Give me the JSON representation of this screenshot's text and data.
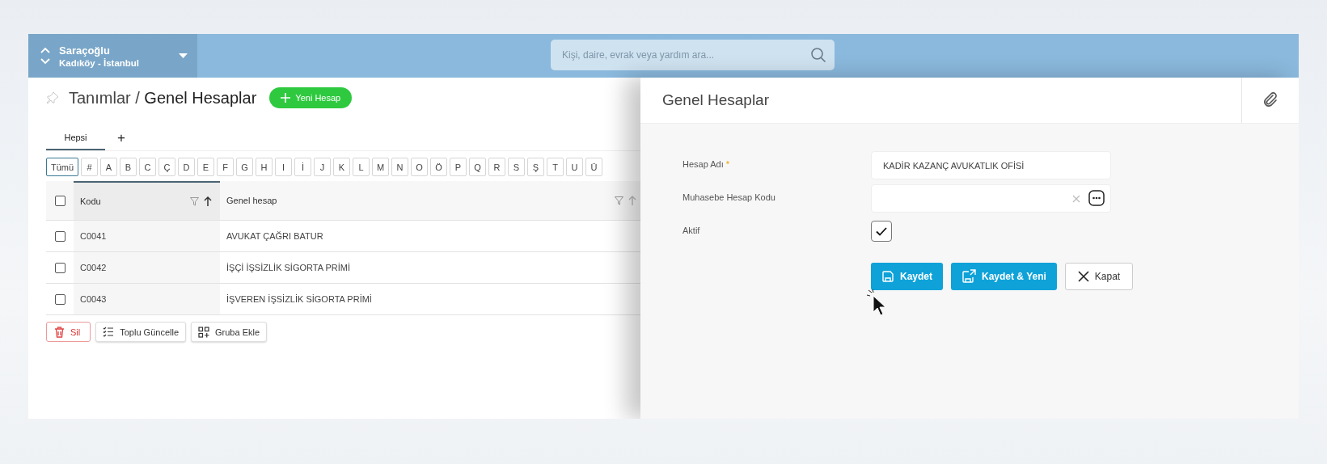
{
  "header": {
    "company": "Saraçoğlu",
    "location": "Kadıköy - İstanbul"
  },
  "search": {
    "placeholder": "Kişi, daire, evrak veya yardım ara..."
  },
  "breadcrumb": {
    "parent": "Tanımlar",
    "separator": "/",
    "current": "Genel Hesaplar"
  },
  "new_button": {
    "label": "Yeni Hesap"
  },
  "tabs": [
    {
      "label": "Hepsi",
      "selected": true
    }
  ],
  "add_tab": "+",
  "letters": [
    {
      "label": "Tümü",
      "selected": true
    },
    {
      "label": "#",
      "selected": false
    },
    {
      "label": "A",
      "selected": false
    },
    {
      "label": "B",
      "selected": false
    },
    {
      "label": "C",
      "selected": false
    },
    {
      "label": "Ç",
      "selected": false
    },
    {
      "label": "D",
      "selected": false
    },
    {
      "label": "E",
      "selected": false
    },
    {
      "label": "F",
      "selected": false
    },
    {
      "label": "G",
      "selected": false
    },
    {
      "label": "H",
      "selected": false
    },
    {
      "label": "I",
      "selected": false
    },
    {
      "label": "İ",
      "selected": false
    },
    {
      "label": "J",
      "selected": false
    },
    {
      "label": "K",
      "selected": false
    },
    {
      "label": "L",
      "selected": false
    },
    {
      "label": "M",
      "selected": false
    },
    {
      "label": "N",
      "selected": false
    },
    {
      "label": "O",
      "selected": false
    },
    {
      "label": "Ö",
      "selected": false
    },
    {
      "label": "P",
      "selected": false
    },
    {
      "label": "Q",
      "selected": false
    },
    {
      "label": "R",
      "selected": false
    },
    {
      "label": "S",
      "selected": false
    },
    {
      "label": "Ş",
      "selected": false
    },
    {
      "label": "T",
      "selected": false
    },
    {
      "label": "U",
      "selected": false
    },
    {
      "label": "Ü",
      "selected": false
    }
  ],
  "table": {
    "all_selected": false,
    "columns": [
      {
        "label": "Kodu",
        "sorted": true
      },
      {
        "label": "Genel hesap",
        "sorted": false
      }
    ],
    "rows": [
      {
        "selected": false,
        "code": "C0041",
        "name": "AVUKAT ÇAĞRI BATUR"
      },
      {
        "selected": false,
        "code": "C0042",
        "name": "İŞÇİ İŞSİZLİK SİGORTA PRİMİ"
      },
      {
        "selected": false,
        "code": "C0043",
        "name": "İŞVEREN İŞSİZLİK SİGORTA PRİMİ"
      }
    ]
  },
  "bulk_actions": [
    {
      "label": "Sil",
      "kind": "delete"
    },
    {
      "label": "Toplu Güncelle",
      "kind": "update"
    },
    {
      "label": "Gruba Ekle",
      "kind": "group"
    }
  ],
  "panel": {
    "title": "Genel Hesaplar",
    "fields": [
      {
        "kind": "text",
        "label": "Hesap Adı",
        "required_mark": "*",
        "value": "KADİR KAZANÇ AVUKATLIK OFİSİ"
      },
      {
        "kind": "lookup",
        "label": "Muhasebe Hesap Kodu"
      },
      {
        "kind": "checkbox",
        "label": "Aktif",
        "checked": true
      }
    ],
    "buttons": [
      {
        "label": "Kaydet",
        "kind": "save"
      },
      {
        "label": "Kaydet & Yeni",
        "kind": "save_new"
      },
      {
        "label": "Kapat",
        "kind": "close"
      }
    ]
  }
}
